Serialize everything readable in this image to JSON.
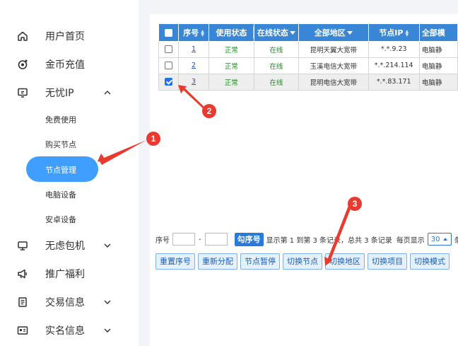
{
  "sidebar": {
    "items": [
      {
        "label": "用户首页",
        "icon": "home-icon"
      },
      {
        "label": "金币充值",
        "icon": "coin-icon"
      },
      {
        "label": "无忧IP",
        "icon": "monitor-chat-icon",
        "expanded": true
      },
      {
        "label": "无虑包机",
        "icon": "desktop-icon"
      },
      {
        "label": "推广福利",
        "icon": "megaphone-icon"
      },
      {
        "label": "交易信息",
        "icon": "document-icon"
      },
      {
        "label": "实名信息",
        "icon": "id-card-icon"
      }
    ],
    "sub_items": [
      {
        "label": "免费使用"
      },
      {
        "label": "购买节点"
      },
      {
        "label": "节点管理",
        "active": true
      },
      {
        "label": "电脑设备"
      },
      {
        "label": "安卓设备"
      }
    ]
  },
  "table": {
    "headers": [
      "序号",
      "使用状态",
      "在线状态",
      "全部地区",
      "节点IP",
      "全部模"
    ],
    "rows": [
      {
        "index": "1",
        "use_status": "正常",
        "online": "在线",
        "region": "昆明天翼大宽带",
        "ip": "*.*.9.23",
        "mode": "电脑静",
        "checked": false
      },
      {
        "index": "2",
        "use_status": "正常",
        "online": "在线",
        "region": "玉溪电信大宽带",
        "ip": "*.*.214.114",
        "mode": "电脑静",
        "checked": false
      },
      {
        "index": "3",
        "use_status": "正常",
        "online": "在线",
        "region": "昆明电信大宽带",
        "ip": "*.*.83.171",
        "mode": "电脑静",
        "checked": true
      }
    ]
  },
  "pager": {
    "label_index": "序号",
    "dash": "-",
    "select_btn": "勾序号",
    "summary": "显示第 1 到第 3 条记录，总共 3 条记录",
    "per_page_label": "每页显示",
    "per_page_value": "30",
    "per_page_suffix": "条"
  },
  "actions": [
    "重置序号",
    "重新分配",
    "节点暂停",
    "切换节点",
    "切换地区",
    "切换项目",
    "切换模式"
  ],
  "markers": [
    "1",
    "2",
    "3"
  ],
  "colors": {
    "accent": "#409eff",
    "header": "#3a86d6",
    "annotation": "#ea3a2f",
    "ok": "#1a8f1a"
  }
}
